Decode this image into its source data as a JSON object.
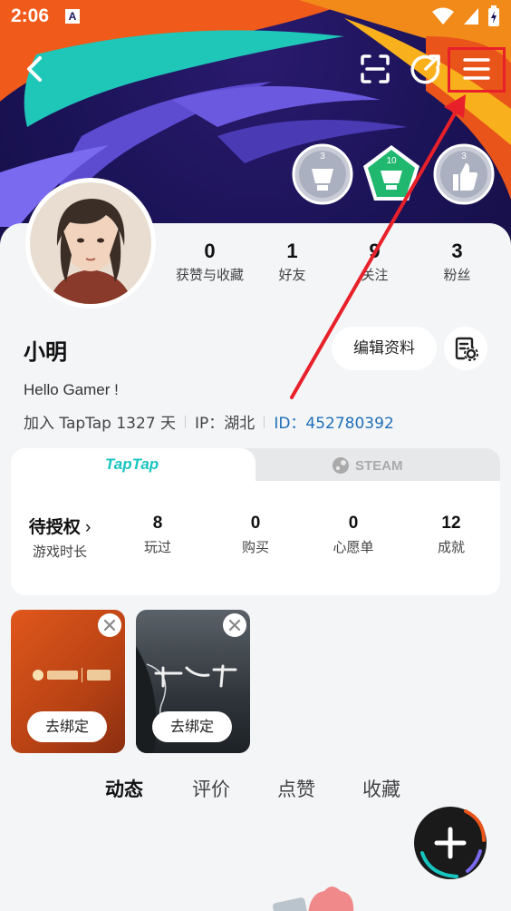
{
  "status_bar": {
    "time": "2:06"
  },
  "stats": [
    {
      "value": "0",
      "label": "获赞与收藏"
    },
    {
      "value": "1",
      "label": "好友"
    },
    {
      "value": "9",
      "label": "关注"
    },
    {
      "value": "3",
      "label": "粉丝"
    }
  ],
  "badges": [
    "3",
    "10",
    "3"
  ],
  "profile": {
    "name": "小明",
    "edit_label": "编辑资料",
    "bio": "Hello Gamer !",
    "joined": "加入 TapTap 1327 天",
    "ip": "IP：湖北",
    "uid": "ID：452780392"
  },
  "platform_tabs": {
    "taptap": "TapTap",
    "steam": "STEAM"
  },
  "platform_stats": [
    {
      "value": "待授权",
      "label": "游戏时长"
    },
    {
      "value": "8",
      "label": "玩过"
    },
    {
      "value": "0",
      "label": "购买"
    },
    {
      "value": "0",
      "label": "心愿单"
    },
    {
      "value": "12",
      "label": "成就"
    }
  ],
  "tiles": [
    {
      "unbind_label": "去绑定"
    },
    {
      "unbind_label": "去绑定"
    }
  ],
  "bottom_tabs": [
    "动态",
    "评价",
    "点赞",
    "收藏"
  ],
  "colors": {
    "accent": "#17c5c0",
    "highlight": "#e8202a",
    "uid": "#1f6fb8"
  }
}
